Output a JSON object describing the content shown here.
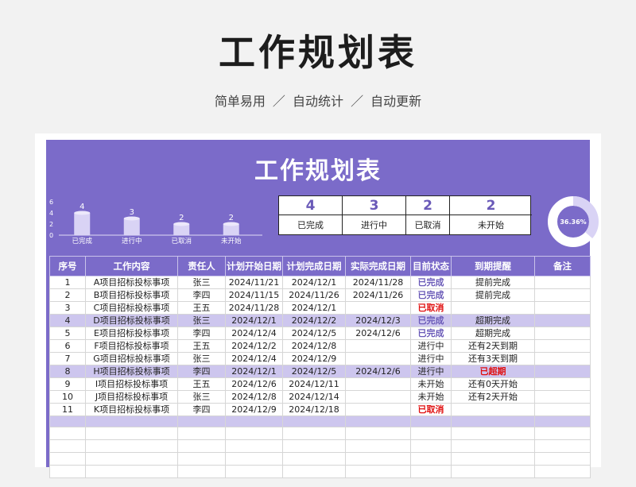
{
  "header": {
    "title": "工作规划表",
    "subtitle": "简单易用  ／  自动统计  ／  自动更新"
  },
  "sheet": {
    "title": "工作规划表"
  },
  "chart_data": {
    "type": "bar",
    "categories": [
      "已完成",
      "进行中",
      "已取消",
      "未开始"
    ],
    "values": [
      4,
      3,
      2,
      2
    ],
    "ylim": [
      0,
      6
    ],
    "yticks": [
      "0",
      "2",
      "4",
      "6"
    ],
    "grid": false,
    "bar_color": "#d9d3f5"
  },
  "stats": [
    {
      "value": "4",
      "label": "已完成"
    },
    {
      "value": "3",
      "label": "进行中"
    },
    {
      "value": "2",
      "label": "已取消"
    },
    {
      "value": "2",
      "label": "未开始"
    }
  ],
  "donut": {
    "label": "36.36%",
    "fraction": 0.3636,
    "color_fill": "#d9d3f5",
    "color_rest": "#ffffff"
  },
  "table": {
    "headers": [
      "序号",
      "工作内容",
      "责任人",
      "计划开始日期",
      "计划完成日期",
      "实际完成日期",
      "目前状态",
      "到期提醒",
      "备注"
    ],
    "rows": [
      {
        "no": "1",
        "task": "A项目招标投标事项",
        "owner": "张三",
        "plan_start": "2024/11/21",
        "plan_end": "2024/12/1",
        "actual_end": "2024/11/28",
        "status": "已完成",
        "remind": "提前完成",
        "note": "",
        "hl": false
      },
      {
        "no": "2",
        "task": "B项目招标投标事项",
        "owner": "李四",
        "plan_start": "2024/11/15",
        "plan_end": "2024/11/26",
        "actual_end": "2024/11/26",
        "status": "已完成",
        "remind": "提前完成",
        "note": "",
        "hl": false
      },
      {
        "no": "3",
        "task": "C项目招标投标事项",
        "owner": "王五",
        "plan_start": "2024/11/28",
        "plan_end": "2024/12/1",
        "actual_end": "",
        "status": "已取消",
        "remind": "",
        "note": "",
        "hl": false
      },
      {
        "no": "4",
        "task": "D项目招标投标事项",
        "owner": "张三",
        "plan_start": "2024/12/1",
        "plan_end": "2024/12/2",
        "actual_end": "2024/12/3",
        "status": "已完成",
        "remind": "超期完成",
        "note": "",
        "hl": true
      },
      {
        "no": "5",
        "task": "E项目招标投标事项",
        "owner": "李四",
        "plan_start": "2024/12/4",
        "plan_end": "2024/12/5",
        "actual_end": "2024/12/6",
        "status": "已完成",
        "remind": "超期完成",
        "note": "",
        "hl": false
      },
      {
        "no": "6",
        "task": "F项目招标投标事项",
        "owner": "王五",
        "plan_start": "2024/12/2",
        "plan_end": "2024/12/8",
        "actual_end": "",
        "status": "进行中",
        "remind": "还有2天到期",
        "note": "",
        "hl": false
      },
      {
        "no": "7",
        "task": "G项目招标投标事项",
        "owner": "张三",
        "plan_start": "2024/12/4",
        "plan_end": "2024/12/9",
        "actual_end": "",
        "status": "进行中",
        "remind": "还有3天到期",
        "note": "",
        "hl": false
      },
      {
        "no": "8",
        "task": "H项目招标投标事项",
        "owner": "李四",
        "plan_start": "2024/12/1",
        "plan_end": "2024/12/5",
        "actual_end": "2024/12/6",
        "status": "进行中",
        "remind": "已超期",
        "note": "",
        "hl": true
      },
      {
        "no": "9",
        "task": "I项目招标投标事项",
        "owner": "王五",
        "plan_start": "2024/12/6",
        "plan_end": "2024/12/11",
        "actual_end": "",
        "status": "未开始",
        "remind": "还有0天开始",
        "note": "",
        "hl": false
      },
      {
        "no": "10",
        "task": "J项目招标投标事项",
        "owner": "张三",
        "plan_start": "2024/12/8",
        "plan_end": "2024/12/14",
        "actual_end": "",
        "status": "未开始",
        "remind": "还有2天开始",
        "note": "",
        "hl": false
      },
      {
        "no": "11",
        "task": "K项目招标投标事项",
        "owner": "李四",
        "plan_start": "2024/12/9",
        "plan_end": "2024/12/18",
        "actual_end": "",
        "status": "已取消",
        "remind": "",
        "note": "",
        "hl": false
      }
    ],
    "empty_rows": 4
  }
}
